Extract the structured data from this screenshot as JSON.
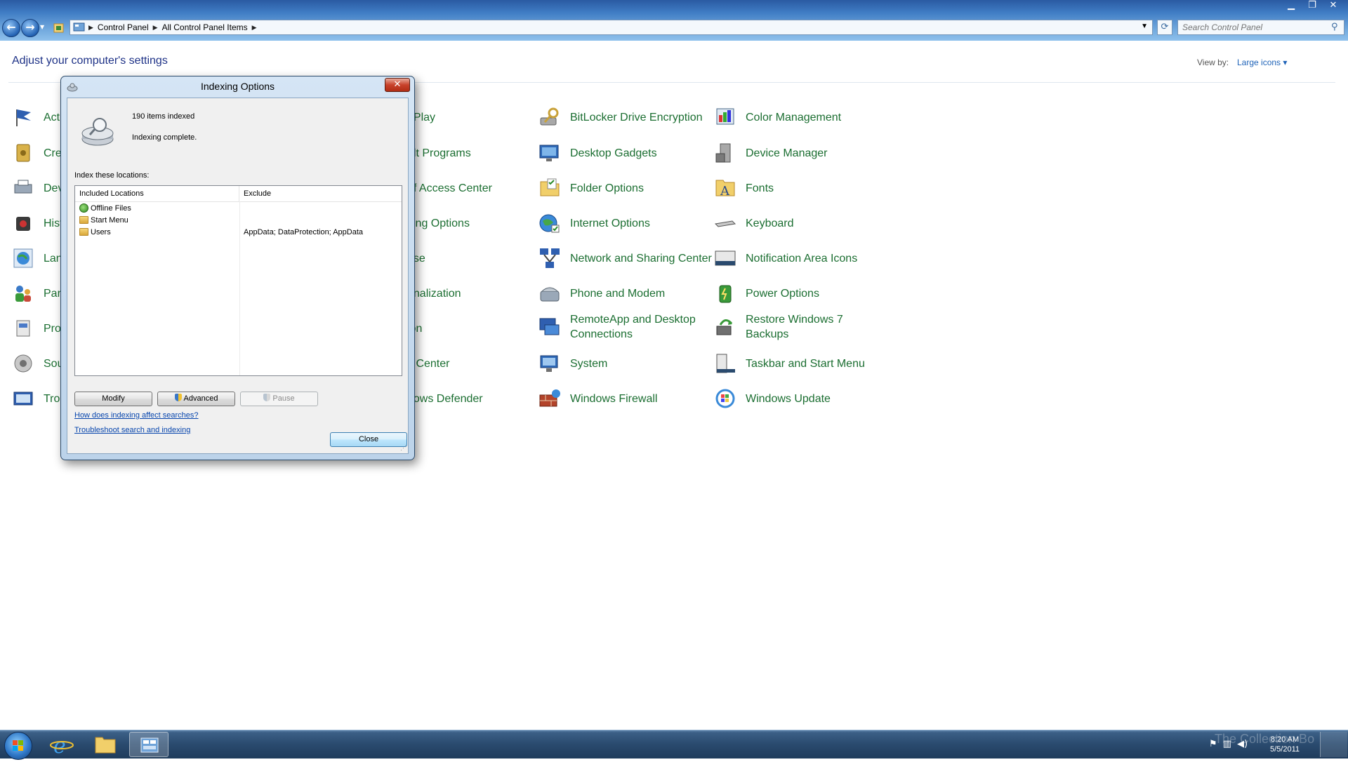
{
  "window": {
    "minimize_glyph": "▁",
    "maximize_glyph": "❐",
    "close_glyph": "✕"
  },
  "nav": {
    "back_glyph": "←",
    "forward_glyph": "→",
    "breadcrumb": [
      "Control Panel",
      "All Control Panel Items"
    ],
    "search_placeholder": "Search Control Panel"
  },
  "content": {
    "title": "Adjust your computer's settings",
    "view_by_label": "View by:",
    "view_by_value": "Large icons ▾",
    "items_col3": [
      "BitLocker Drive Encryption",
      "Desktop Gadgets",
      "Folder Options",
      "Internet Options",
      "Network and Sharing Center",
      "Phone and Modem",
      "RemoteApp and Desktop Connections",
      "System",
      "Windows Firewall"
    ],
    "items_col4": [
      "Color Management",
      "Device Manager",
      "Fonts",
      "Keyboard",
      "Notification Area Icons",
      "Power Options",
      "Restore Windows 7 Backups",
      "Taskbar and Start Menu",
      "Windows Update"
    ],
    "items_col2_partial": [
      "oPlay",
      "ult Programs",
      "of Access Center",
      "xing Options",
      "use",
      "onalization",
      "ion",
      "c Center",
      "dows Defender"
    ],
    "items_col1_partial": [
      "Acti",
      "Cre",
      "Dev",
      "Hist",
      "Lan",
      "Par",
      "Pro",
      "Sou",
      "Tro"
    ]
  },
  "dialog": {
    "title": "Indexing Options",
    "close_glyph": "✕",
    "items_indexed": "190 items indexed",
    "status": "Indexing complete.",
    "index_label": "Index these locations:",
    "columns": [
      "Included Locations",
      "Exclude"
    ],
    "locations": [
      {
        "name": "Offline Files",
        "exclude": ""
      },
      {
        "name": "Start Menu",
        "exclude": ""
      },
      {
        "name": "Users",
        "exclude": "AppData; DataProtection; AppData"
      }
    ],
    "buttons": {
      "modify": "Modify",
      "advanced": "Advanced",
      "pause": "Pause",
      "close": "Close"
    },
    "links": [
      "How does indexing affect searches?",
      "Troubleshoot search and indexing"
    ]
  },
  "taskbar": {
    "time": "8:20 AM",
    "date": "5/5/2011",
    "watermark": "The Collection Bo"
  },
  "colors": {
    "link_green": "#1b6e31",
    "title_blue": "#1e3287",
    "hyperlink": "#0645ad"
  }
}
